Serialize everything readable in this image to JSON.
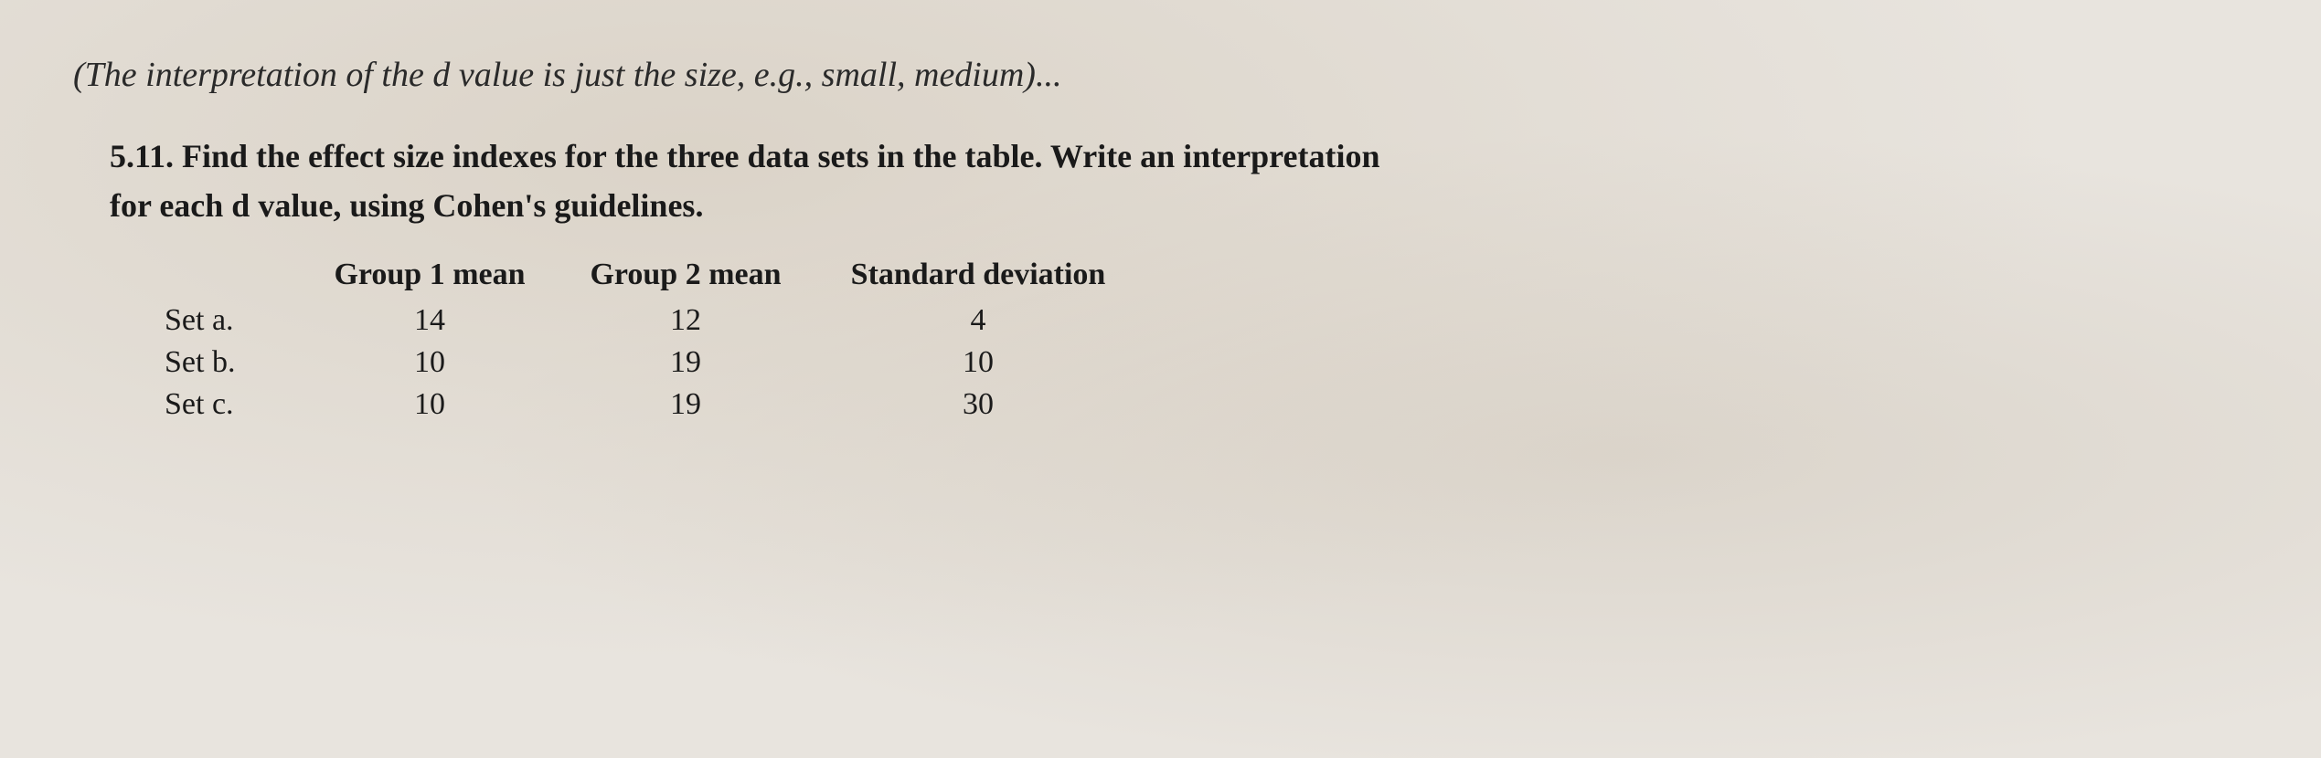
{
  "intro": {
    "text": "(The interpretation of the d value is just the size, e.g., small, medium)..."
  },
  "problem": {
    "number": "5.11.",
    "description": "Find the effect size indexes for the three data sets in the table. Write an interpretation for each d value, using Cohen's guidelines.",
    "table": {
      "headers": {
        "row_label": "",
        "group1_mean": "Group 1 mean",
        "group2_mean": "Group 2 mean",
        "std_dev": "Standard deviation"
      },
      "rows": [
        {
          "label": "Set a.",
          "group1": "14",
          "group2": "12",
          "stddev": "4"
        },
        {
          "label": "Set b.",
          "group1": "10",
          "group2": "19",
          "stddev": "10"
        },
        {
          "label": "Set c.",
          "group1": "10",
          "group2": "19",
          "stddev": "30"
        }
      ]
    }
  }
}
